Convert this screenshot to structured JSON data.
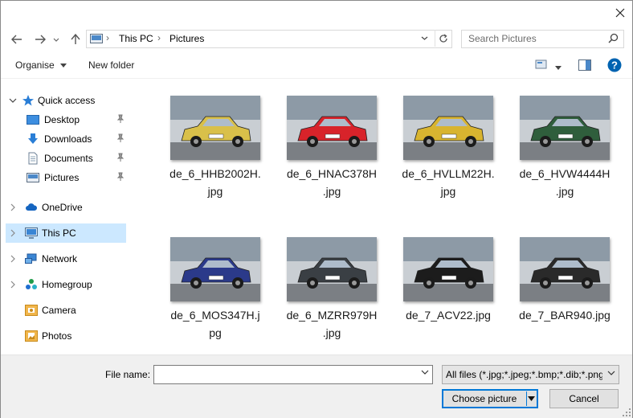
{
  "nav": {
    "breadcrumb": [
      "This PC",
      "Pictures"
    ]
  },
  "search": {
    "placeholder": "Search Pictures"
  },
  "toolbar": {
    "organise_label": "Organise",
    "new_folder_label": "New folder"
  },
  "sidebar": {
    "items": [
      {
        "label": "Quick access",
        "icon": "star-icon"
      },
      {
        "label": "Desktop",
        "icon": "desktop-folder-icon"
      },
      {
        "label": "Downloads",
        "icon": "download-arrow-icon"
      },
      {
        "label": "Documents",
        "icon": "document-icon"
      },
      {
        "label": "Pictures",
        "icon": "pictures-folder-icon"
      },
      {
        "label": "OneDrive",
        "icon": "cloud-icon"
      },
      {
        "label": "This PC",
        "icon": "computer-icon"
      },
      {
        "label": "Network",
        "icon": "network-icon"
      },
      {
        "label": "Homegroup",
        "icon": "homegroup-icon"
      },
      {
        "label": "Camera",
        "icon": "camera-folder-icon"
      },
      {
        "label": "Photos",
        "icon": "photos-folder-icon"
      }
    ],
    "selected": "This PC"
  },
  "files": [
    {
      "name": "de_6_HHB2002H.jpg",
      "line1": "de_6_HHB2002H.",
      "line2": "jpg",
      "car_color": "#d9c04a"
    },
    {
      "name": "de_6_HNAC378H.jpg",
      "line1": "de_6_HNAC378H",
      "line2": ".jpg",
      "car_color": "#d8232a"
    },
    {
      "name": "de_6_HVLLM22H.jpg",
      "line1": "de_6_HVLLM22H.",
      "line2": "jpg",
      "car_color": "#d8b430"
    },
    {
      "name": "de_6_HVW4444H.jpg",
      "line1": "de_6_HVW4444H",
      "line2": ".jpg",
      "car_color": "#2f5e3c"
    },
    {
      "name": "de_6_MOS347H.jpg",
      "line1": "de_6_MOS347H.j",
      "line2": "pg",
      "car_color": "#2b3a8a"
    },
    {
      "name": "de_6_MZRR979H.jpg",
      "line1": "de_6_MZRR979H",
      "line2": ".jpg",
      "car_color": "#3a3f44"
    },
    {
      "name": "de_7_ACV22.jpg",
      "line1": "de_7_ACV22.jpg",
      "line2": "",
      "car_color": "#1c1c1c"
    },
    {
      "name": "de_7_BAR940.jpg",
      "line1": "de_7_BAR940.jpg",
      "line2": "",
      "car_color": "#2a2a2a"
    }
  ],
  "footer": {
    "file_name_label": "File name:",
    "file_name_value": "",
    "filter_label": "All files (*.jpg;*.jpeg;*.bmp;*.dib;*.png",
    "choose_label": "Choose picture",
    "cancel_label": "Cancel"
  },
  "colors": {
    "accent": "#0078d7",
    "selection": "#cce8ff",
    "help": "#0063b1"
  }
}
